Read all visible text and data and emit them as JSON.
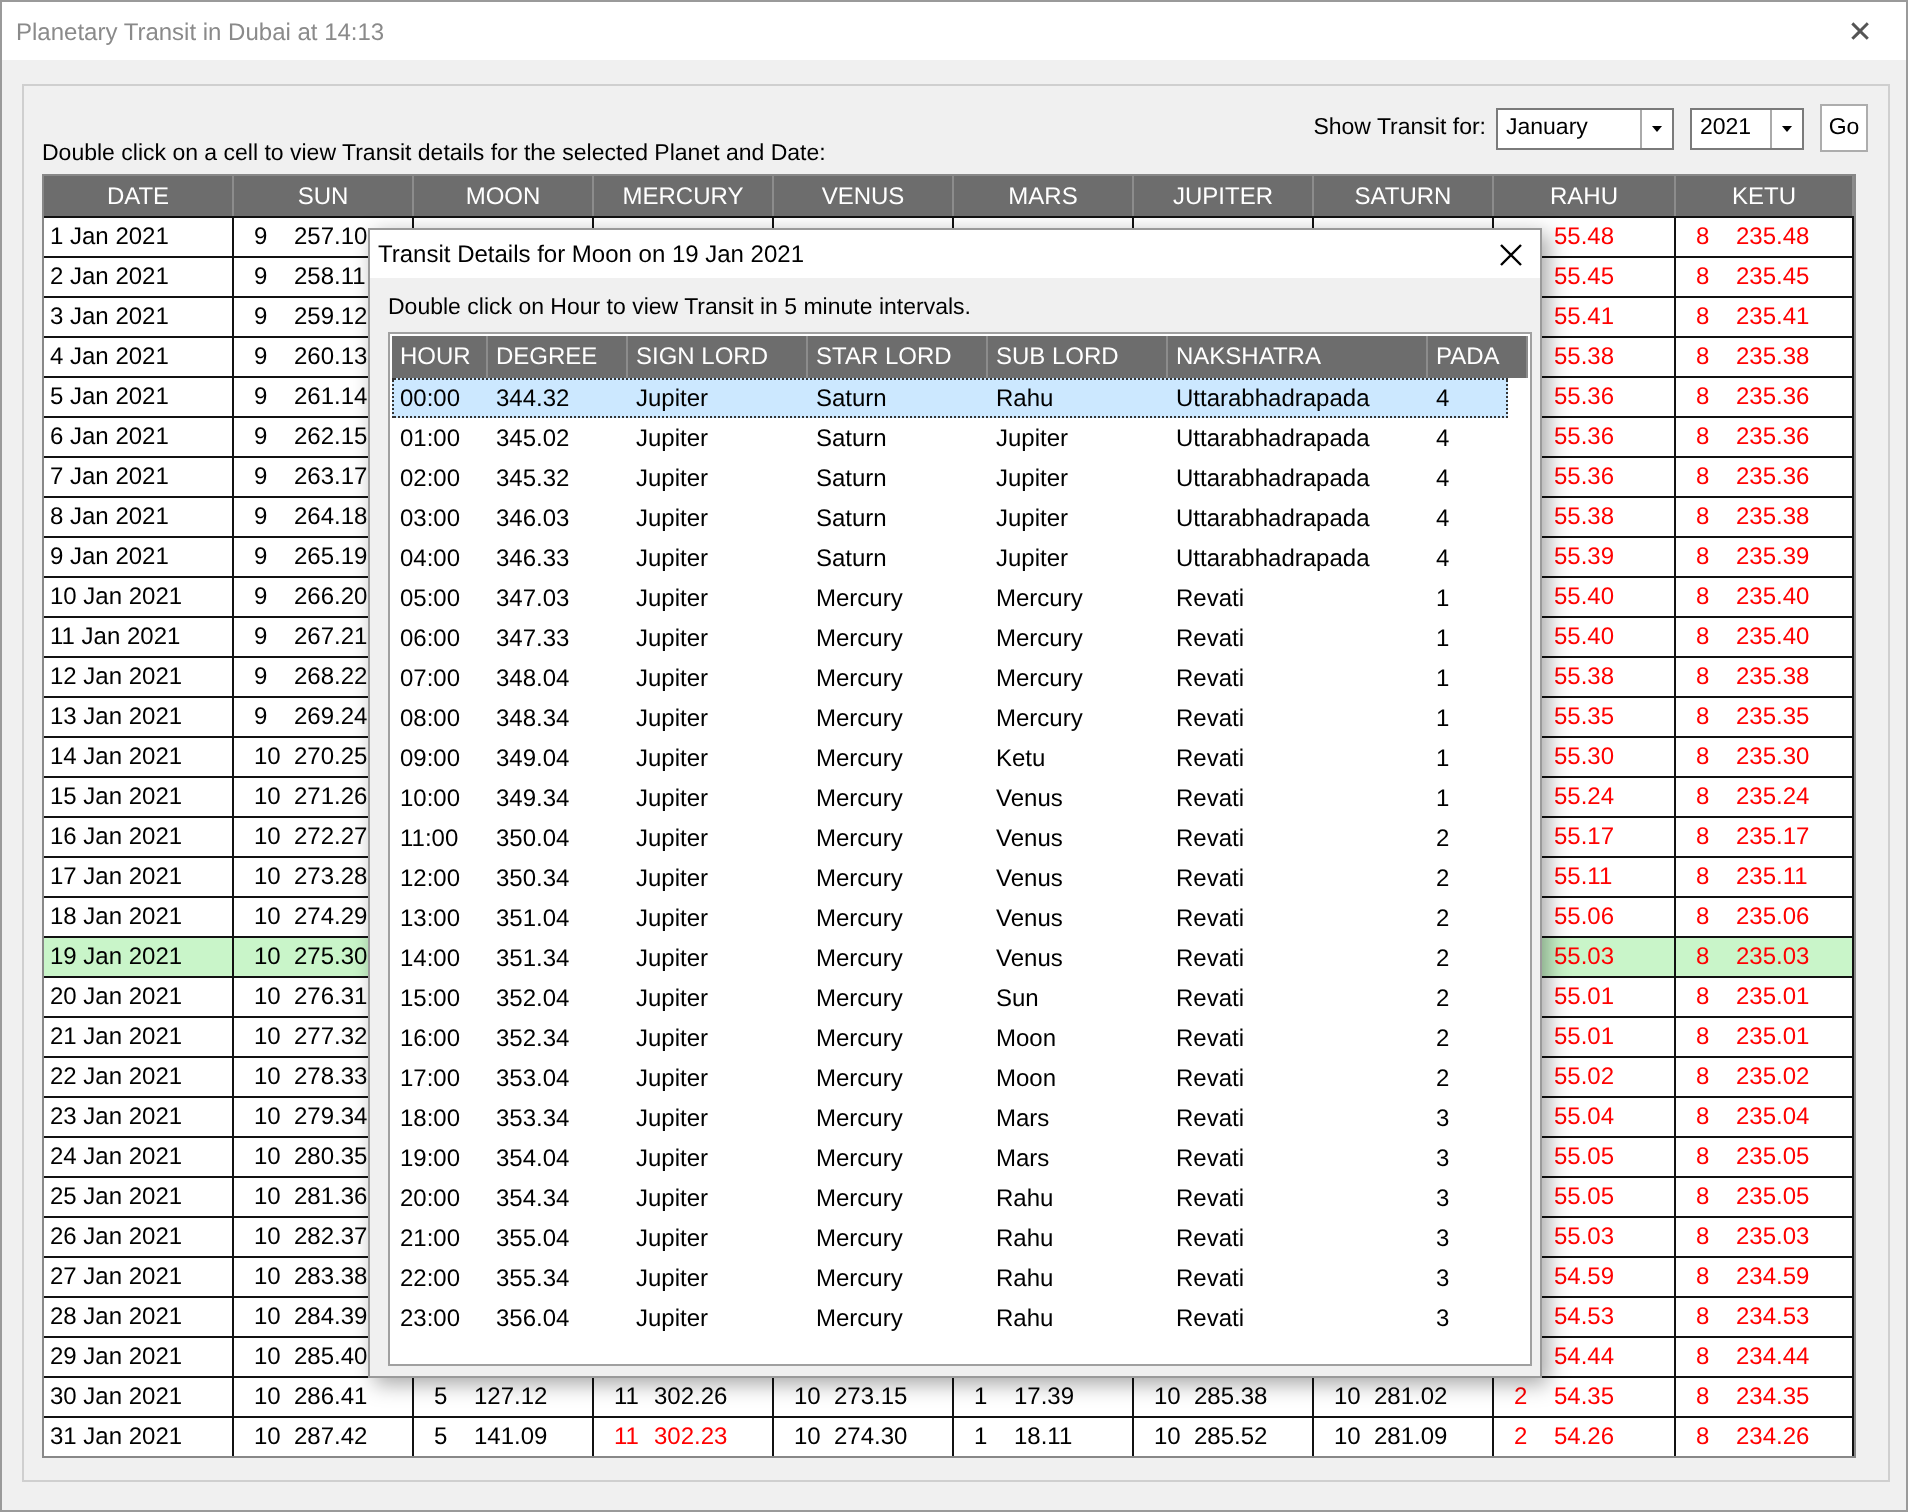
{
  "window": {
    "title": "Planetary Transit in Dubai at 14:13",
    "close": "✕"
  },
  "controls": {
    "label": "Show Transit for:",
    "month": "January",
    "year": "2021",
    "go": "Go"
  },
  "hint": "Double click on a cell to view Transit details for the selected Planet and Date:",
  "table": {
    "columns": [
      "DATE",
      "SUN",
      "MOON",
      "MERCURY",
      "VENUS",
      "MARS",
      "JUPITER",
      "SATURN",
      "RAHU",
      "KETU"
    ],
    "rows": [
      {
        "selected": false,
        "cells": [
          "1 Jan 2021",
          {
            "sign": "9",
            "degree": "257.10",
            "retro": false
          },
          null,
          null,
          null,
          null,
          null,
          null,
          {
            "degree": "55.48",
            "retro": true
          },
          {
            "sign": "8",
            "degree": "235.48",
            "retro": true
          }
        ]
      },
      {
        "selected": false,
        "cells": [
          "2 Jan 2021",
          {
            "sign": "9",
            "degree": "258.11",
            "retro": false
          },
          null,
          null,
          null,
          null,
          null,
          null,
          {
            "degree": "55.45",
            "retro": true
          },
          {
            "sign": "8",
            "degree": "235.45",
            "retro": true
          }
        ]
      },
      {
        "selected": false,
        "cells": [
          "3 Jan 2021",
          {
            "sign": "9",
            "degree": "259.12",
            "retro": false
          },
          null,
          null,
          null,
          null,
          null,
          null,
          {
            "degree": "55.41",
            "retro": true
          },
          {
            "sign": "8",
            "degree": "235.41",
            "retro": true
          }
        ]
      },
      {
        "selected": false,
        "cells": [
          "4 Jan 2021",
          {
            "sign": "9",
            "degree": "260.13",
            "retro": false
          },
          null,
          null,
          null,
          null,
          null,
          null,
          {
            "degree": "55.38",
            "retro": true
          },
          {
            "sign": "8",
            "degree": "235.38",
            "retro": true
          }
        ]
      },
      {
        "selected": false,
        "cells": [
          "5 Jan 2021",
          {
            "sign": "9",
            "degree": "261.14",
            "retro": false
          },
          null,
          null,
          null,
          null,
          null,
          null,
          {
            "degree": "55.36",
            "retro": true
          },
          {
            "sign": "8",
            "degree": "235.36",
            "retro": true
          }
        ]
      },
      {
        "selected": false,
        "cells": [
          "6 Jan 2021",
          {
            "sign": "9",
            "degree": "262.15",
            "retro": false
          },
          null,
          null,
          null,
          null,
          null,
          null,
          {
            "degree": "55.36",
            "retro": true
          },
          {
            "sign": "8",
            "degree": "235.36",
            "retro": true
          }
        ]
      },
      {
        "selected": false,
        "cells": [
          "7 Jan 2021",
          {
            "sign": "9",
            "degree": "263.17",
            "retro": false
          },
          null,
          null,
          null,
          null,
          null,
          null,
          {
            "degree": "55.36",
            "retro": true
          },
          {
            "sign": "8",
            "degree": "235.36",
            "retro": true
          }
        ]
      },
      {
        "selected": false,
        "cells": [
          "8 Jan 2021",
          {
            "sign": "9",
            "degree": "264.18",
            "retro": false
          },
          null,
          null,
          null,
          null,
          null,
          null,
          {
            "degree": "55.38",
            "retro": true
          },
          {
            "sign": "8",
            "degree": "235.38",
            "retro": true
          }
        ]
      },
      {
        "selected": false,
        "cells": [
          "9 Jan 2021",
          {
            "sign": "9",
            "degree": "265.19",
            "retro": false
          },
          null,
          null,
          null,
          null,
          null,
          null,
          {
            "degree": "55.39",
            "retro": true
          },
          {
            "sign": "8",
            "degree": "235.39",
            "retro": true
          }
        ]
      },
      {
        "selected": false,
        "cells": [
          "10 Jan 2021",
          {
            "sign": "9",
            "degree": "266.20",
            "retro": false
          },
          null,
          null,
          null,
          null,
          null,
          null,
          {
            "degree": "55.40",
            "retro": true
          },
          {
            "sign": "8",
            "degree": "235.40",
            "retro": true
          }
        ]
      },
      {
        "selected": false,
        "cells": [
          "11 Jan 2021",
          {
            "sign": "9",
            "degree": "267.21",
            "retro": false
          },
          null,
          null,
          null,
          null,
          null,
          null,
          {
            "degree": "55.40",
            "retro": true
          },
          {
            "sign": "8",
            "degree": "235.40",
            "retro": true
          }
        ]
      },
      {
        "selected": false,
        "cells": [
          "12 Jan 2021",
          {
            "sign": "9",
            "degree": "268.22",
            "retro": false
          },
          null,
          null,
          null,
          null,
          null,
          null,
          {
            "degree": "55.38",
            "retro": true
          },
          {
            "sign": "8",
            "degree": "235.38",
            "retro": true
          }
        ]
      },
      {
        "selected": false,
        "cells": [
          "13 Jan 2021",
          {
            "sign": "9",
            "degree": "269.24",
            "retro": false
          },
          null,
          null,
          null,
          null,
          null,
          null,
          {
            "degree": "55.35",
            "retro": true
          },
          {
            "sign": "8",
            "degree": "235.35",
            "retro": true
          }
        ]
      },
      {
        "selected": false,
        "cells": [
          "14 Jan 2021",
          {
            "sign": "10",
            "degree": "270.25",
            "retro": false
          },
          null,
          null,
          null,
          null,
          null,
          null,
          {
            "degree": "55.30",
            "retro": true
          },
          {
            "sign": "8",
            "degree": "235.30",
            "retro": true
          }
        ]
      },
      {
        "selected": false,
        "cells": [
          "15 Jan 2021",
          {
            "sign": "10",
            "degree": "271.26",
            "retro": false
          },
          null,
          null,
          null,
          null,
          null,
          null,
          {
            "degree": "55.24",
            "retro": true
          },
          {
            "sign": "8",
            "degree": "235.24",
            "retro": true
          }
        ]
      },
      {
        "selected": false,
        "cells": [
          "16 Jan 2021",
          {
            "sign": "10",
            "degree": "272.27",
            "retro": false
          },
          null,
          null,
          null,
          null,
          null,
          null,
          {
            "degree": "55.17",
            "retro": true
          },
          {
            "sign": "8",
            "degree": "235.17",
            "retro": true
          }
        ]
      },
      {
        "selected": false,
        "cells": [
          "17 Jan 2021",
          {
            "sign": "10",
            "degree": "273.28",
            "retro": false
          },
          null,
          null,
          null,
          null,
          null,
          null,
          {
            "degree": "55.11",
            "retro": true
          },
          {
            "sign": "8",
            "degree": "235.11",
            "retro": true
          }
        ]
      },
      {
        "selected": false,
        "cells": [
          "18 Jan 2021",
          {
            "sign": "10",
            "degree": "274.29",
            "retro": false
          },
          null,
          null,
          null,
          null,
          null,
          null,
          {
            "degree": "55.06",
            "retro": true
          },
          {
            "sign": "8",
            "degree": "235.06",
            "retro": true
          }
        ]
      },
      {
        "selected": true,
        "cells": [
          "19 Jan 2021",
          {
            "sign": "10",
            "degree": "275.30",
            "retro": false
          },
          null,
          null,
          null,
          null,
          null,
          null,
          {
            "degree": "55.03",
            "retro": true
          },
          {
            "sign": "8",
            "degree": "235.03",
            "retro": true
          }
        ]
      },
      {
        "selected": false,
        "cells": [
          "20 Jan 2021",
          {
            "sign": "10",
            "degree": "276.31",
            "retro": false
          },
          null,
          null,
          null,
          null,
          null,
          null,
          {
            "degree": "55.01",
            "retro": true
          },
          {
            "sign": "8",
            "degree": "235.01",
            "retro": true
          }
        ]
      },
      {
        "selected": false,
        "cells": [
          "21 Jan 2021",
          {
            "sign": "10",
            "degree": "277.32",
            "retro": false
          },
          null,
          null,
          null,
          null,
          null,
          null,
          {
            "degree": "55.01",
            "retro": true
          },
          {
            "sign": "8",
            "degree": "235.01",
            "retro": true
          }
        ]
      },
      {
        "selected": false,
        "cells": [
          "22 Jan 2021",
          {
            "sign": "10",
            "degree": "278.33",
            "retro": false
          },
          null,
          null,
          null,
          null,
          null,
          null,
          {
            "degree": "55.02",
            "retro": true
          },
          {
            "sign": "8",
            "degree": "235.02",
            "retro": true
          }
        ]
      },
      {
        "selected": false,
        "cells": [
          "23 Jan 2021",
          {
            "sign": "10",
            "degree": "279.34",
            "retro": false
          },
          null,
          null,
          null,
          null,
          null,
          null,
          {
            "degree": "55.04",
            "retro": true
          },
          {
            "sign": "8",
            "degree": "235.04",
            "retro": true
          }
        ]
      },
      {
        "selected": false,
        "cells": [
          "24 Jan 2021",
          {
            "sign": "10",
            "degree": "280.35",
            "retro": false
          },
          null,
          null,
          null,
          null,
          null,
          null,
          {
            "degree": "55.05",
            "retro": true
          },
          {
            "sign": "8",
            "degree": "235.05",
            "retro": true
          }
        ]
      },
      {
        "selected": false,
        "cells": [
          "25 Jan 2021",
          {
            "sign": "10",
            "degree": "281.36",
            "retro": false
          },
          null,
          null,
          null,
          null,
          null,
          null,
          {
            "degree": "55.05",
            "retro": true
          },
          {
            "sign": "8",
            "degree": "235.05",
            "retro": true
          }
        ]
      },
      {
        "selected": false,
        "cells": [
          "26 Jan 2021",
          {
            "sign": "10",
            "degree": "282.37",
            "retro": false
          },
          null,
          null,
          null,
          null,
          null,
          null,
          {
            "degree": "55.03",
            "retro": true
          },
          {
            "sign": "8",
            "degree": "235.03",
            "retro": true
          }
        ]
      },
      {
        "selected": false,
        "cells": [
          "27 Jan 2021",
          {
            "sign": "10",
            "degree": "283.38",
            "retro": false
          },
          null,
          null,
          null,
          null,
          null,
          null,
          {
            "degree": "54.59",
            "retro": true
          },
          {
            "sign": "8",
            "degree": "234.59",
            "retro": true
          }
        ]
      },
      {
        "selected": false,
        "cells": [
          "28 Jan 2021",
          {
            "sign": "10",
            "degree": "284.39",
            "retro": false
          },
          null,
          null,
          null,
          null,
          null,
          null,
          {
            "degree": "54.53",
            "retro": true
          },
          {
            "sign": "8",
            "degree": "234.53",
            "retro": true
          }
        ]
      },
      {
        "selected": false,
        "cells": [
          "29 Jan 2021",
          {
            "sign": "10",
            "degree": "285.40",
            "retro": false
          },
          null,
          null,
          null,
          null,
          null,
          null,
          {
            "degree": "54.44",
            "retro": true
          },
          {
            "sign": "8",
            "degree": "234.44",
            "retro": true
          }
        ]
      },
      {
        "selected": false,
        "cells": [
          "30 Jan 2021",
          {
            "sign": "10",
            "degree": "286.41",
            "retro": false
          },
          {
            "sign": "5",
            "degree": "127.12",
            "retro": false
          },
          {
            "sign": "11",
            "degree": "302.26",
            "retro": false
          },
          {
            "sign": "10",
            "degree": "273.15",
            "retro": false
          },
          {
            "sign": "1",
            "degree": "17.39",
            "retro": false
          },
          {
            "sign": "10",
            "degree": "285.38",
            "retro": false
          },
          {
            "sign": "10",
            "degree": "281.02",
            "retro": false
          },
          {
            "sign": "2",
            "degree": "54.35",
            "retro": true
          },
          {
            "sign": "8",
            "degree": "234.35",
            "retro": true
          }
        ]
      },
      {
        "selected": false,
        "cells": [
          "31 Jan 2021",
          {
            "sign": "10",
            "degree": "287.42",
            "retro": false
          },
          {
            "sign": "5",
            "degree": "141.09",
            "retro": false
          },
          {
            "sign": "11",
            "degree": "302.23",
            "retro": true
          },
          {
            "sign": "10",
            "degree": "274.30",
            "retro": false
          },
          {
            "sign": "1",
            "degree": "18.11",
            "retro": false
          },
          {
            "sign": "10",
            "degree": "285.52",
            "retro": false
          },
          {
            "sign": "10",
            "degree": "281.09",
            "retro": false
          },
          {
            "sign": "2",
            "degree": "54.26",
            "retro": true
          },
          {
            "sign": "8",
            "degree": "234.26",
            "retro": true
          }
        ]
      }
    ]
  },
  "dialog": {
    "title": "Transit Details for Moon on 19 Jan 2021",
    "hint": "Double click on Hour to view Transit in 5 minute intervals.",
    "columns": [
      "HOUR",
      "DEGREE",
      "SIGN LORD",
      "STAR LORD",
      "SUB LORD",
      "NAKSHATRA",
      "PADA"
    ],
    "rows": [
      {
        "selected": true,
        "cells": [
          "00:00",
          "344.32",
          "Jupiter",
          "Saturn",
          "Rahu",
          "Uttarabhadrapada",
          "4"
        ]
      },
      {
        "selected": false,
        "cells": [
          "01:00",
          "345.02",
          "Jupiter",
          "Saturn",
          "Jupiter",
          "Uttarabhadrapada",
          "4"
        ]
      },
      {
        "selected": false,
        "cells": [
          "02:00",
          "345.32",
          "Jupiter",
          "Saturn",
          "Jupiter",
          "Uttarabhadrapada",
          "4"
        ]
      },
      {
        "selected": false,
        "cells": [
          "03:00",
          "346.03",
          "Jupiter",
          "Saturn",
          "Jupiter",
          "Uttarabhadrapada",
          "4"
        ]
      },
      {
        "selected": false,
        "cells": [
          "04:00",
          "346.33",
          "Jupiter",
          "Saturn",
          "Jupiter",
          "Uttarabhadrapada",
          "4"
        ]
      },
      {
        "selected": false,
        "cells": [
          "05:00",
          "347.03",
          "Jupiter",
          "Mercury",
          "Mercury",
          "Revati",
          "1"
        ]
      },
      {
        "selected": false,
        "cells": [
          "06:00",
          "347.33",
          "Jupiter",
          "Mercury",
          "Mercury",
          "Revati",
          "1"
        ]
      },
      {
        "selected": false,
        "cells": [
          "07:00",
          "348.04",
          "Jupiter",
          "Mercury",
          "Mercury",
          "Revati",
          "1"
        ]
      },
      {
        "selected": false,
        "cells": [
          "08:00",
          "348.34",
          "Jupiter",
          "Mercury",
          "Mercury",
          "Revati",
          "1"
        ]
      },
      {
        "selected": false,
        "cells": [
          "09:00",
          "349.04",
          "Jupiter",
          "Mercury",
          "Ketu",
          "Revati",
          "1"
        ]
      },
      {
        "selected": false,
        "cells": [
          "10:00",
          "349.34",
          "Jupiter",
          "Mercury",
          "Venus",
          "Revati",
          "1"
        ]
      },
      {
        "selected": false,
        "cells": [
          "11:00",
          "350.04",
          "Jupiter",
          "Mercury",
          "Venus",
          "Revati",
          "2"
        ]
      },
      {
        "selected": false,
        "cells": [
          "12:00",
          "350.34",
          "Jupiter",
          "Mercury",
          "Venus",
          "Revati",
          "2"
        ]
      },
      {
        "selected": false,
        "cells": [
          "13:00",
          "351.04",
          "Jupiter",
          "Mercury",
          "Venus",
          "Revati",
          "2"
        ]
      },
      {
        "selected": false,
        "cells": [
          "14:00",
          "351.34",
          "Jupiter",
          "Mercury",
          "Venus",
          "Revati",
          "2"
        ]
      },
      {
        "selected": false,
        "cells": [
          "15:00",
          "352.04",
          "Jupiter",
          "Mercury",
          "Sun",
          "Revati",
          "2"
        ]
      },
      {
        "selected": false,
        "cells": [
          "16:00",
          "352.34",
          "Jupiter",
          "Mercury",
          "Moon",
          "Revati",
          "2"
        ]
      },
      {
        "selected": false,
        "cells": [
          "17:00",
          "353.04",
          "Jupiter",
          "Mercury",
          "Moon",
          "Revati",
          "2"
        ]
      },
      {
        "selected": false,
        "cells": [
          "18:00",
          "353.34",
          "Jupiter",
          "Mercury",
          "Mars",
          "Revati",
          "3"
        ]
      },
      {
        "selected": false,
        "cells": [
          "19:00",
          "354.04",
          "Jupiter",
          "Mercury",
          "Mars",
          "Revati",
          "3"
        ]
      },
      {
        "selected": false,
        "cells": [
          "20:00",
          "354.34",
          "Jupiter",
          "Mercury",
          "Rahu",
          "Revati",
          "3"
        ]
      },
      {
        "selected": false,
        "cells": [
          "21:00",
          "355.04",
          "Jupiter",
          "Mercury",
          "Rahu",
          "Revati",
          "3"
        ]
      },
      {
        "selected": false,
        "cells": [
          "22:00",
          "355.34",
          "Jupiter",
          "Mercury",
          "Rahu",
          "Revati",
          "3"
        ]
      },
      {
        "selected": false,
        "cells": [
          "23:00",
          "356.04",
          "Jupiter",
          "Mercury",
          "Rahu",
          "Revati",
          "3"
        ]
      }
    ]
  }
}
